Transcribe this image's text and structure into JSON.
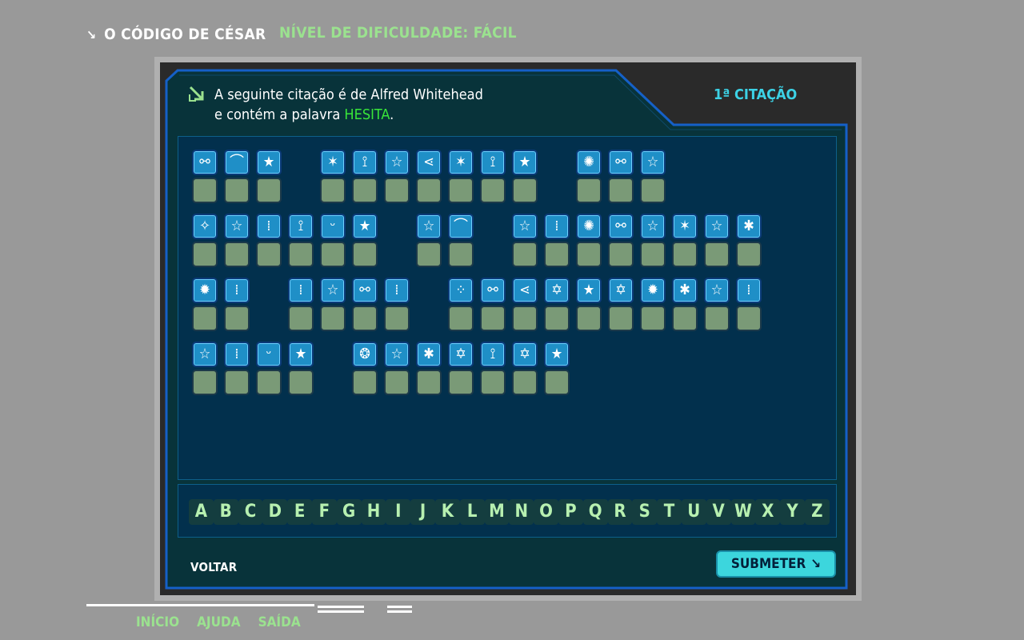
{
  "header": {
    "title": "O CÓDIGO DE CÉSAR",
    "difficulty": "NÍVEL DE DIFICULDADE:  FÁCIL"
  },
  "panel": {
    "intro_before": "A seguinte citação é de Alfred Whitehead",
    "intro_line2_before": "e contém a palavra ",
    "keyword": "HESITA",
    "intro_line2_after": ".",
    "quote_number": "1ª CITAÇÃO"
  },
  "cipher_rows": [
    [
      [
        "link-h",
        "curve",
        "star5"
      ],
      [
        "star6",
        "branch",
        "star5o",
        "share",
        "star6",
        "branch",
        "star5"
      ],
      [
        "burst",
        "link-h",
        "star5o"
      ]
    ],
    [
      [
        "sparkle",
        "star5o",
        "link-v",
        "branch",
        "link-w",
        "star5"
      ],
      [
        "star5o",
        "curve"
      ],
      [
        "star5o",
        "link-v",
        "burst",
        "link-h",
        "star5o",
        "star6",
        "star5o",
        "asterisk"
      ]
    ],
    [
      [
        "sun",
        "link-v"
      ],
      [
        "link-v",
        "star5o",
        "link-h",
        "link-v"
      ],
      [
        "dots",
        "link-h",
        "share",
        "star6o",
        "star5",
        "star6o",
        "sun",
        "asterisk",
        "star5o",
        "link-v"
      ]
    ],
    [
      [
        "star5o",
        "link-v",
        "link-w",
        "star5"
      ],
      [
        "ring",
        "star5o",
        "asterisk",
        "star6o",
        "branch",
        "star6o",
        "star5"
      ]
    ]
  ],
  "alphabet": [
    "A",
    "B",
    "C",
    "D",
    "E",
    "F",
    "G",
    "H",
    "I",
    "J",
    "K",
    "L",
    "M",
    "N",
    "O",
    "P",
    "Q",
    "R",
    "S",
    "T",
    "U",
    "V",
    "W",
    "X",
    "Y",
    "Z"
  ],
  "actions": {
    "back": "VOLTAR",
    "submit": "SUBMETER"
  },
  "footer": {
    "home": "INÍCIO",
    "help": "AJUDA",
    "exit": "SAÍDA"
  },
  "colors": {
    "accent_cyan": "#3cd2e6",
    "accent_green": "#39e639",
    "symbol_tile": "#1f8fc7",
    "answer_slot": "#7a9a77"
  }
}
